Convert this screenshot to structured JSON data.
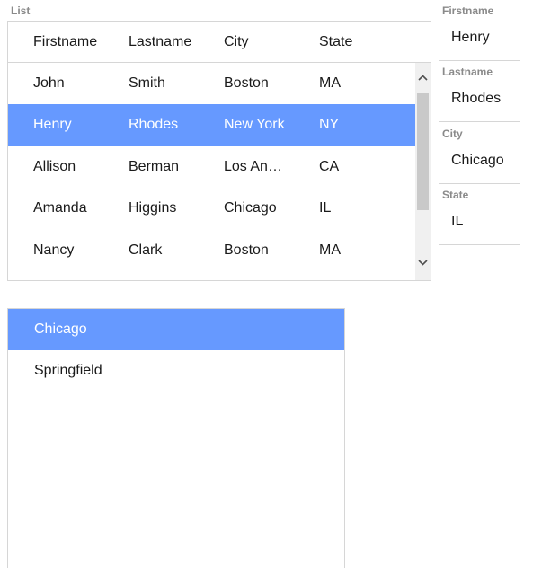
{
  "list": {
    "label": "List",
    "columns": [
      "Firstname",
      "Lastname",
      "City",
      "State"
    ],
    "rows": [
      {
        "firstname": "John",
        "lastname": "Smith",
        "city": "Boston",
        "state": "MA",
        "selected": false
      },
      {
        "firstname": "Henry",
        "lastname": "Rhodes",
        "city": "New York",
        "state": "NY",
        "selected": true
      },
      {
        "firstname": "Allison",
        "lastname": "Berman",
        "city": "Los Angeles",
        "state": "CA",
        "selected": false
      },
      {
        "firstname": "Amanda",
        "lastname": "Higgins",
        "city": "Chicago",
        "state": "IL",
        "selected": false
      },
      {
        "firstname": "Nancy",
        "lastname": "Clark",
        "city": "Boston",
        "state": "MA",
        "selected": false
      }
    ],
    "scroll_up_icon": "chevron-up-icon",
    "scroll_down_icon": "chevron-down-icon"
  },
  "details": {
    "firstname": {
      "label": "Firstname",
      "value": "Henry"
    },
    "lastname": {
      "label": "Lastname",
      "value": "Rhodes"
    },
    "city": {
      "label": "City",
      "value": "Chicago"
    },
    "state": {
      "label": "State",
      "value": "IL"
    }
  },
  "city_list": {
    "items": [
      {
        "label": "Chicago",
        "selected": true
      },
      {
        "label": "Springfield",
        "selected": false
      }
    ]
  },
  "colors": {
    "selection": "#6699ff",
    "border": "#d6d6d6",
    "label": "#8a8a8a"
  }
}
